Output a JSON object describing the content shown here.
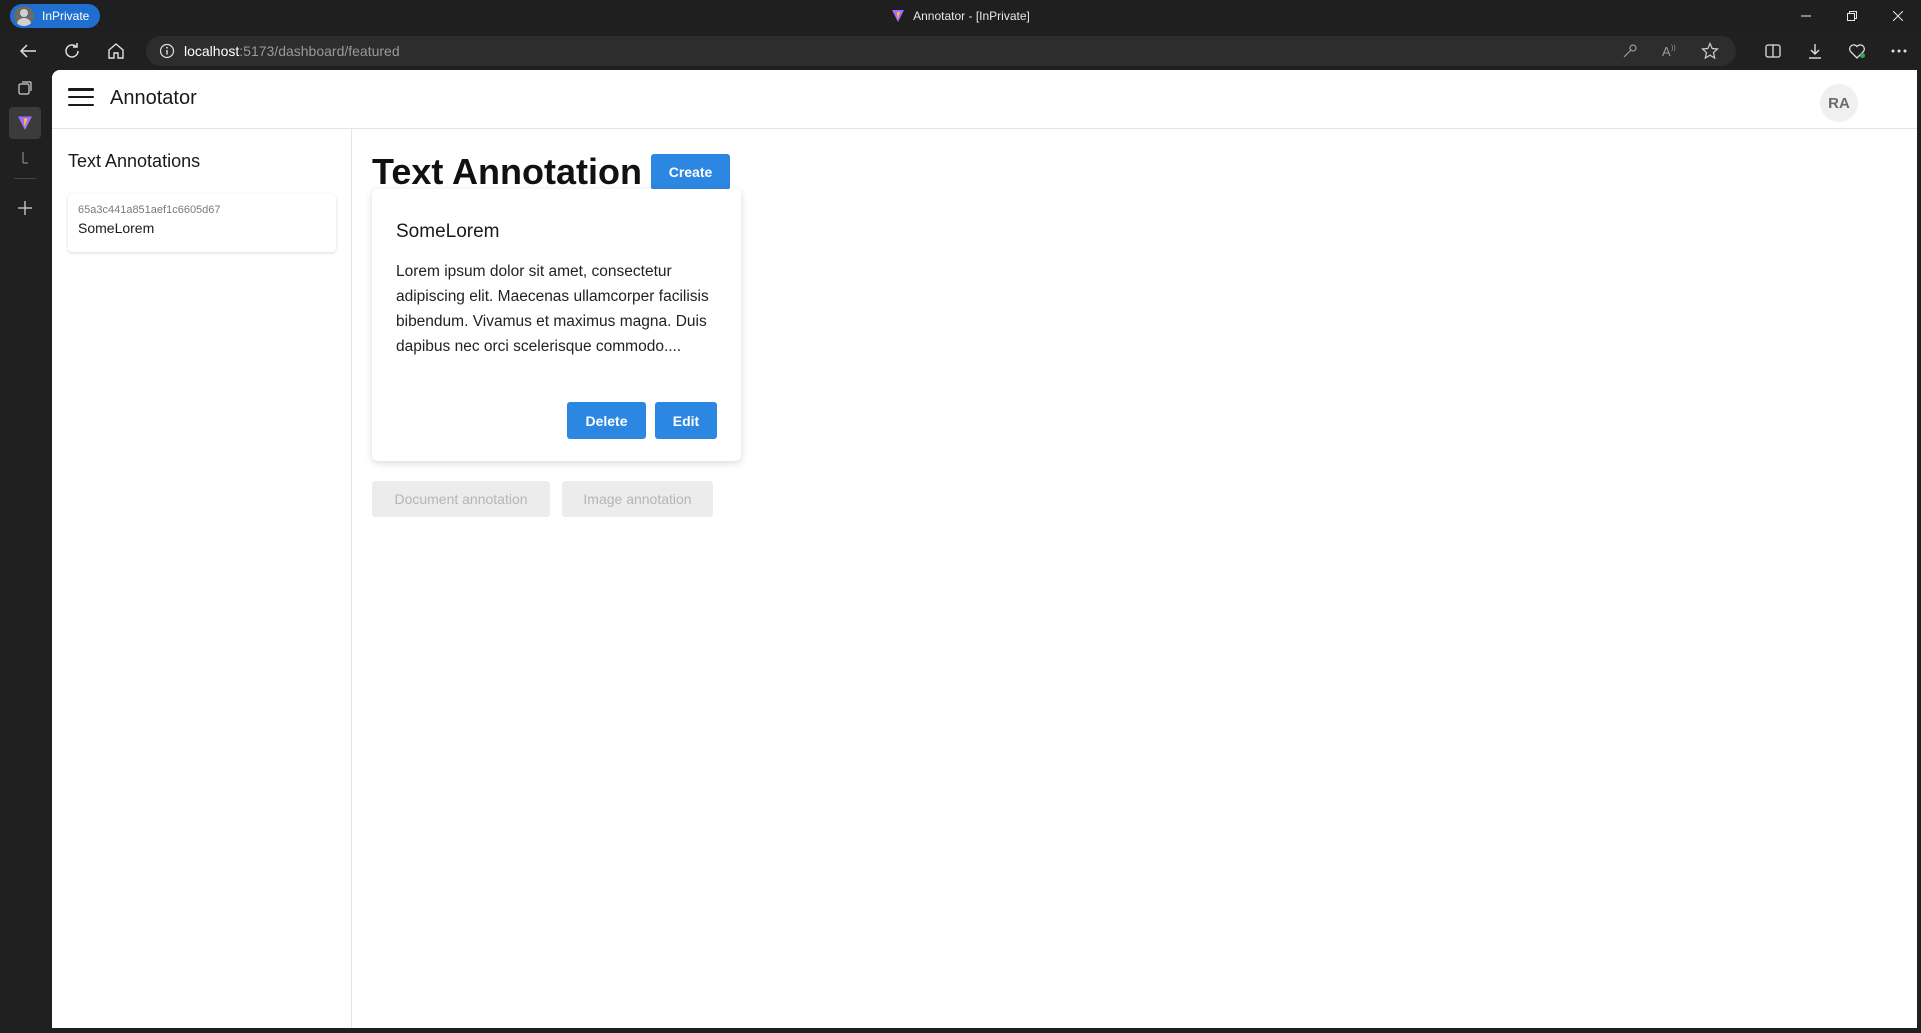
{
  "browser": {
    "profile_label": "InPrivate",
    "window_title": "Annotator - [InPrivate]",
    "url_host": "localhost",
    "url_rest": ":5173/dashboard/featured"
  },
  "app": {
    "title": "Annotator",
    "user_initials": "RA"
  },
  "sidebar": {
    "heading": "Text Annotations",
    "items": [
      {
        "id": "65a3c441a851aef1c6605d67",
        "name": "SomeLorem"
      }
    ]
  },
  "main": {
    "title": "Text Annotation",
    "create_label": "Create",
    "card": {
      "title": "SomeLorem",
      "body": "Lorem ipsum dolor sit amet, consectetur adipiscing elit. Maecenas ullamcorper facilisis bibendum. Vivamus et maximus magna. Duis dapibus nec orci scelerisque commodo....",
      "delete_label": "Delete",
      "edit_label": "Edit"
    },
    "document_annotation_label": "Document annotation",
    "image_annotation_label": "Image annotation"
  },
  "colors": {
    "primary": "#2c87e3",
    "disabled_bg": "#ececec",
    "inprivate": "#1e6fd0"
  }
}
